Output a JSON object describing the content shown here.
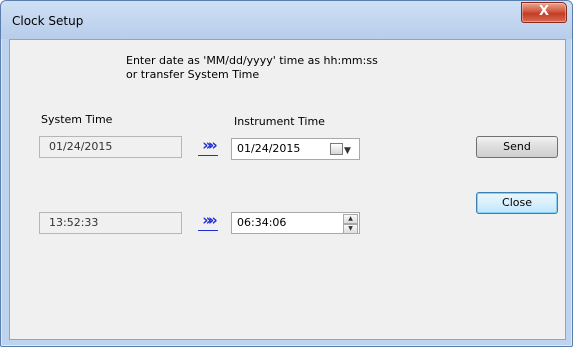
{
  "window": {
    "title": "Clock Setup",
    "close_glyph": "X"
  },
  "instructions": "Enter date as 'MM/dd/yyyy' time as hh:mm:ss\nor transfer System Time",
  "system": {
    "label": "System Time",
    "date": "01/24/2015",
    "time": "13:52:33"
  },
  "instrument": {
    "label": "Instrument Time",
    "date": "01/24/2015",
    "time": "06:34:06"
  },
  "transfer_glyph": "»»",
  "buttons": {
    "send": "Send",
    "close": "Close"
  },
  "icons": {
    "calendar": "calendar-icon",
    "dropdown": "chevron-down-icon",
    "spin_up": "triangle-up-icon",
    "spin_down": "triangle-down-icon",
    "transfer": "double-chevron-right-icon"
  },
  "colors": {
    "title_bar": "#bed3ee",
    "close_button": "#c43b24",
    "transfer_arrow": "#1f2fd6",
    "default_button_border": "#3c7fb1"
  }
}
